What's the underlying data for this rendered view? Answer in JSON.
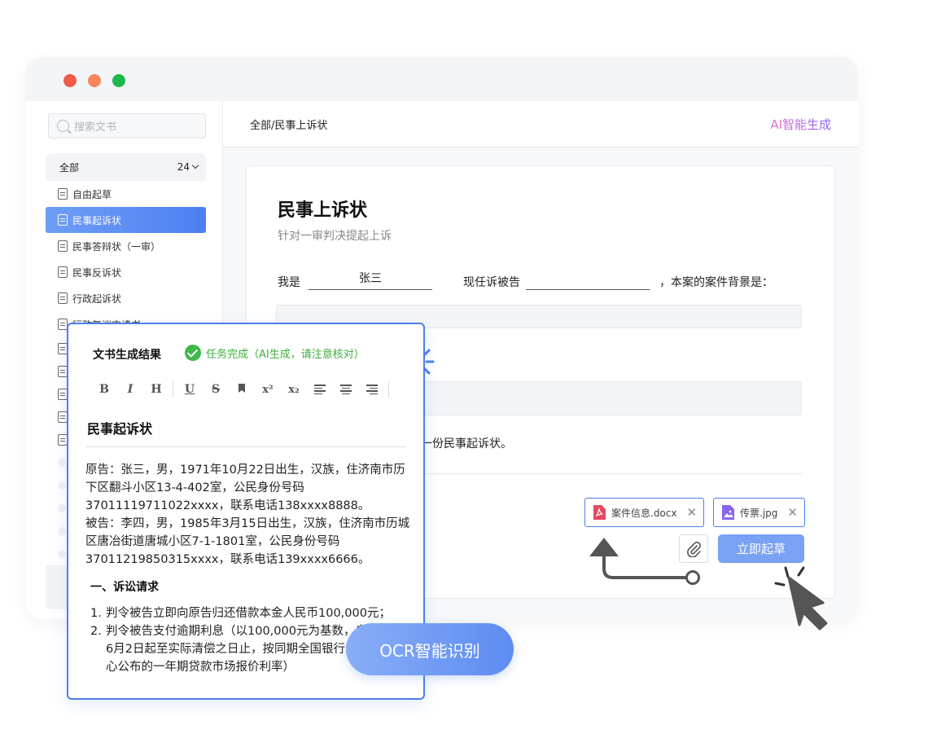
{
  "window": {
    "controls": [
      "close",
      "minimize",
      "maximize"
    ]
  },
  "sidebar": {
    "search_placeholder": "搜索文书",
    "group_label": "全部",
    "group_count": "24",
    "items": [
      {
        "label": "自由起草",
        "active": false
      },
      {
        "label": "民事起诉状",
        "active": true
      },
      {
        "label": "民事答辩状（一审）",
        "active": false
      },
      {
        "label": "民事反诉状",
        "active": false
      },
      {
        "label": "行政起诉状",
        "active": false
      },
      {
        "label": "行政复议申请书",
        "active": false
      }
    ]
  },
  "header": {
    "breadcrumb": "全部/民事上诉状",
    "ai_label": "AI智能生成"
  },
  "form": {
    "title": "民事上诉状",
    "subtitle": "针对一审判决提起上诉",
    "label_i_am": "我是",
    "value_i_am": "张三",
    "label_defendant": "现任诉被告",
    "value_defendant": "",
    "label_background": "，本案的案件背景是：",
    "generate_line": "一份民事起诉状。",
    "attachments": [
      {
        "name": "案件信息.docx",
        "icon": "pdf-file-icon",
        "color": "#e84a5f"
      },
      {
        "name": "传票.jpg",
        "icon": "image-file-icon",
        "color": "#8a63f0"
      }
    ],
    "attach_icon": "paperclip-icon",
    "draft_button": "立即起草"
  },
  "result_popup": {
    "title": "文书生成结果",
    "status": "任务完成（AI生成，请注意核对）",
    "toolbar": [
      "B",
      "I",
      "H",
      "U",
      "S",
      "bookmark",
      "x²",
      "x₂",
      "align-left",
      "align-center",
      "align-right"
    ],
    "doc_title": "民事起诉状",
    "plaintiff": "原告：张三，男，1971年10月22日出生，汉族，住济南市历下区翻斗小区13-4-402室，公民身份号码37011119711022xxxx，联系电话138xxxx8888。",
    "defendant": "被告：李四，男，1985年3月15日出生，汉族，住济南市历城区唐冶街道唐城小区7-1-1801室，公民身份号码37011219850315xxxx，联系电话139xxxx6666。",
    "section_title": "一、诉讼请求",
    "claims": [
      {
        "num": "1.",
        "text": "判令被告立即向原告归还借款本金人民币100,000元；"
      },
      {
        "num": "2.",
        "text": "判令被告支付逾期利息（以100,000元为基数，自2024年6月2日起至实际清偿之日止，按同期全国银行间同业拆借中心公布的一年期贷款市场报价利率）"
      }
    ]
  },
  "ocr_badge": "OCR智能识别",
  "colors": {
    "accent": "#4d7ff0",
    "success": "#3cb94a",
    "ai_gradient_start": "#e46fd0",
    "ai_gradient_end": "#8a63f0"
  }
}
